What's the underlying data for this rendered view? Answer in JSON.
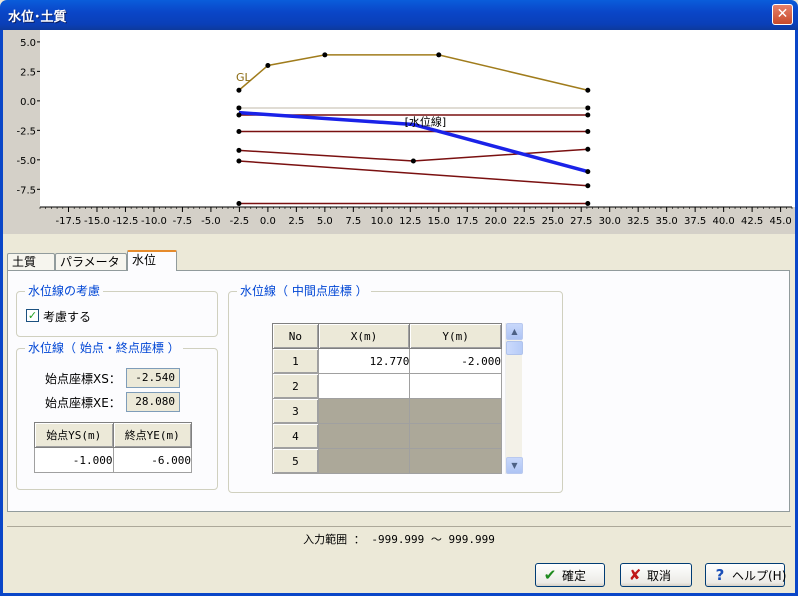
{
  "window": {
    "title": "水位･土質",
    "close_glyph": "✕"
  },
  "chart_data": {
    "type": "line",
    "x_ticks": [
      "-17.5",
      "-15.0",
      "-12.5",
      "-10.0",
      "-7.5",
      "-5.0",
      "-2.5",
      "0.0",
      "2.5",
      "5.0",
      "7.5",
      "10.0",
      "12.5",
      "15.0",
      "17.5",
      "20.0",
      "22.5",
      "25.0",
      "27.5",
      "30.0",
      "32.5",
      "35.0",
      "37.5",
      "40.0",
      "42.5",
      "45.0"
    ],
    "y_ticks": [
      "5.0",
      "2.5",
      "0.0",
      "-2.5",
      "-5.0",
      "-7.5"
    ],
    "xlim": [
      -20,
      46
    ],
    "ylim": [
      -9,
      5.5
    ],
    "annotations": [
      {
        "text": "GL",
        "x": -2.8,
        "y": 1.7
      },
      {
        "text": "[水位線]",
        "x": 12.0,
        "y": -2.1
      }
    ],
    "series": [
      {
        "color": "#a07c1c",
        "width": 1.5,
        "points": [
          [
            -2.54,
            0.9
          ],
          [
            0,
            3.0
          ],
          [
            5,
            3.9
          ],
          [
            15,
            3.9
          ],
          [
            28.08,
            0.9
          ]
        ]
      },
      {
        "color": "#c0b8a8",
        "width": 1,
        "points": [
          [
            -2.54,
            -0.6
          ],
          [
            28.08,
            -0.6
          ]
        ]
      },
      {
        "color": "#7a1010",
        "width": 1.5,
        "points": [
          [
            -2.54,
            -1.2
          ],
          [
            28.08,
            -1.2
          ]
        ]
      },
      {
        "color": "#7a1010",
        "width": 1.5,
        "points": [
          [
            -2.54,
            -2.6
          ],
          [
            28.08,
            -2.6
          ]
        ]
      },
      {
        "color": "#7a1010",
        "width": 1.5,
        "points": [
          [
            -2.54,
            -4.2
          ],
          [
            12.77,
            -5.1
          ],
          [
            28.08,
            -4.1
          ]
        ]
      },
      {
        "color": "#7a1010",
        "width": 1.5,
        "points": [
          [
            -2.54,
            -5.1
          ],
          [
            28.08,
            -7.2
          ]
        ]
      },
      {
        "color": "#7a1010",
        "width": 1.5,
        "points": [
          [
            -2.54,
            -8.7
          ],
          [
            28.08,
            -8.7
          ]
        ]
      },
      {
        "color": "#1a22e8",
        "width": 3.5,
        "points": [
          [
            -2.54,
            -1.0
          ],
          [
            12.77,
            -2.0
          ],
          [
            28.08,
            -6.0
          ]
        ]
      }
    ],
    "markers": [
      [
        -2.54,
        0.9
      ],
      [
        0,
        3.0
      ],
      [
        5,
        3.9
      ],
      [
        15,
        3.9
      ],
      [
        28.08,
        0.9
      ],
      [
        -2.54,
        -0.6
      ],
      [
        28.08,
        -0.6
      ],
      [
        -2.54,
        -1.2
      ],
      [
        28.08,
        -1.2
      ],
      [
        -2.54,
        -2.6
      ],
      [
        28.08,
        -2.6
      ],
      [
        -2.54,
        -4.2
      ],
      [
        12.77,
        -5.1
      ],
      [
        28.08,
        -4.1
      ],
      [
        -2.54,
        -5.1
      ],
      [
        28.08,
        -7.2
      ],
      [
        -2.54,
        -8.7
      ],
      [
        28.08,
        -8.7
      ],
      [
        28.08,
        -6.0
      ]
    ]
  },
  "tabs": [
    "土質",
    "パラメータ",
    "水位"
  ],
  "active_tab": 2,
  "consider_group": {
    "title": "水位線の考慮",
    "checkbox_label": "考慮する",
    "checked": true,
    "check_glyph": "✓"
  },
  "endpoints_group": {
    "title": "水位線（ 始点・終点座標 ）",
    "xs_label": "始点座標XS：",
    "xs_value": "-2.540",
    "xe_label": "始点座標XE：",
    "xe_value": "28.080",
    "headers": [
      "始点YS(m)",
      "終点YE(m)"
    ],
    "values": [
      "-1.000",
      "-6.000"
    ]
  },
  "mid_group": {
    "title": "水位線（ 中間点座標 ）",
    "headers": [
      "No",
      "X(m)",
      "Y(m)"
    ],
    "rows": [
      {
        "no": "1",
        "x": "12.770",
        "y": "-2.000",
        "enabled": true
      },
      {
        "no": "2",
        "x": "",
        "y": "",
        "enabled": true
      },
      {
        "no": "3",
        "x": "",
        "y": "",
        "enabled": false
      },
      {
        "no": "4",
        "x": "",
        "y": "",
        "enabled": false
      },
      {
        "no": "5",
        "x": "",
        "y": "",
        "enabled": false
      }
    ]
  },
  "status": {
    "range_text": "入力範囲 ： -999.999 〜 999.999"
  },
  "buttons": {
    "ok": {
      "label": "確定",
      "icon": "✔",
      "color": "#1e8a1e"
    },
    "cancel": {
      "label": "取消",
      "icon": "✘",
      "color": "#c01818"
    },
    "help": {
      "label": "ヘルプ(H)",
      "icon": "?",
      "color": "#1a4fb8"
    }
  }
}
